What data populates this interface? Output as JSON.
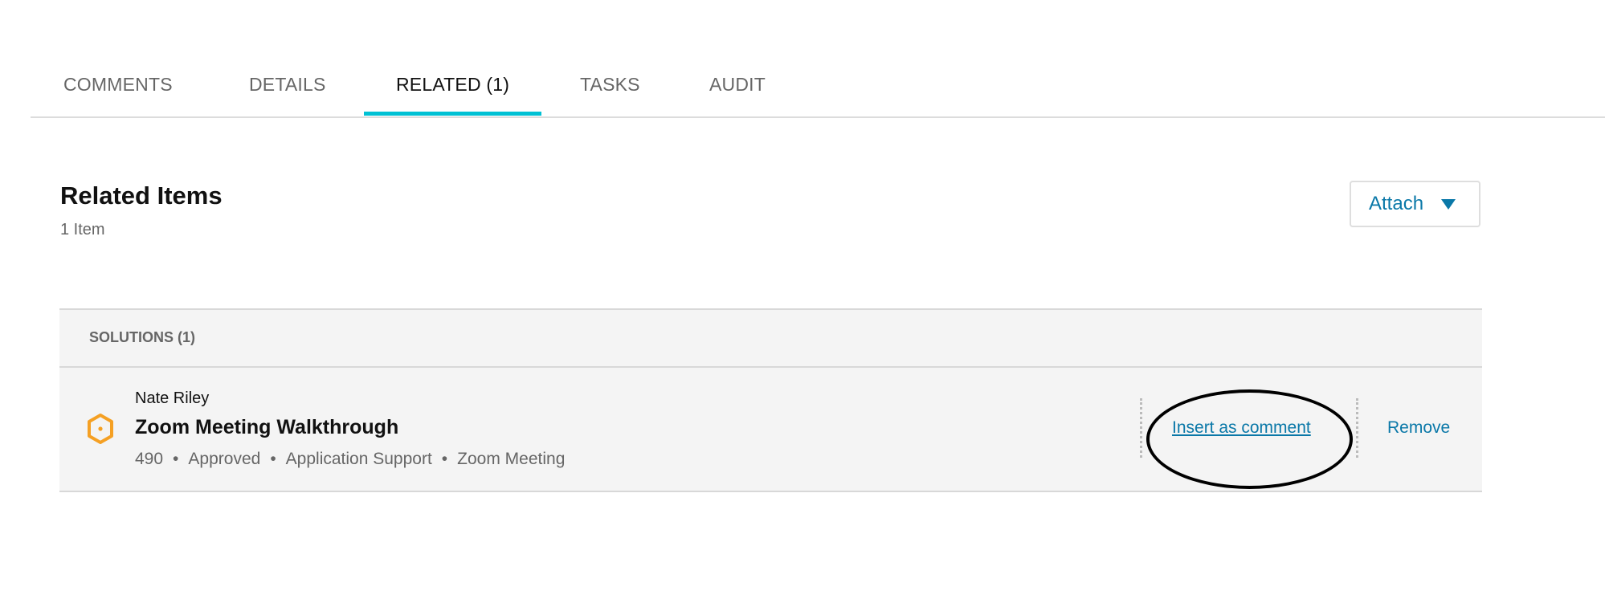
{
  "tabs": [
    {
      "label": "COMMENTS"
    },
    {
      "label": "DETAILS"
    },
    {
      "label": "RELATED (1)",
      "active": true
    },
    {
      "label": "TASKS"
    },
    {
      "label": "AUDIT"
    }
  ],
  "section": {
    "title": "Related Items",
    "count": "1 Item",
    "attach_label": "Attach"
  },
  "group": {
    "label": "SOLUTIONS (1)",
    "items": [
      {
        "author": "Nate Riley",
        "title": "Zoom Meeting Walkthrough",
        "meta": [
          "490",
          "Approved",
          "Application Support",
          "Zoom Meeting"
        ],
        "separator": "•",
        "actions": {
          "insert": "Insert as comment",
          "remove": "Remove"
        }
      }
    ]
  },
  "colors": {
    "accent": "#00c1d4",
    "link": "#0a78a8",
    "icon": "#f5a023"
  }
}
